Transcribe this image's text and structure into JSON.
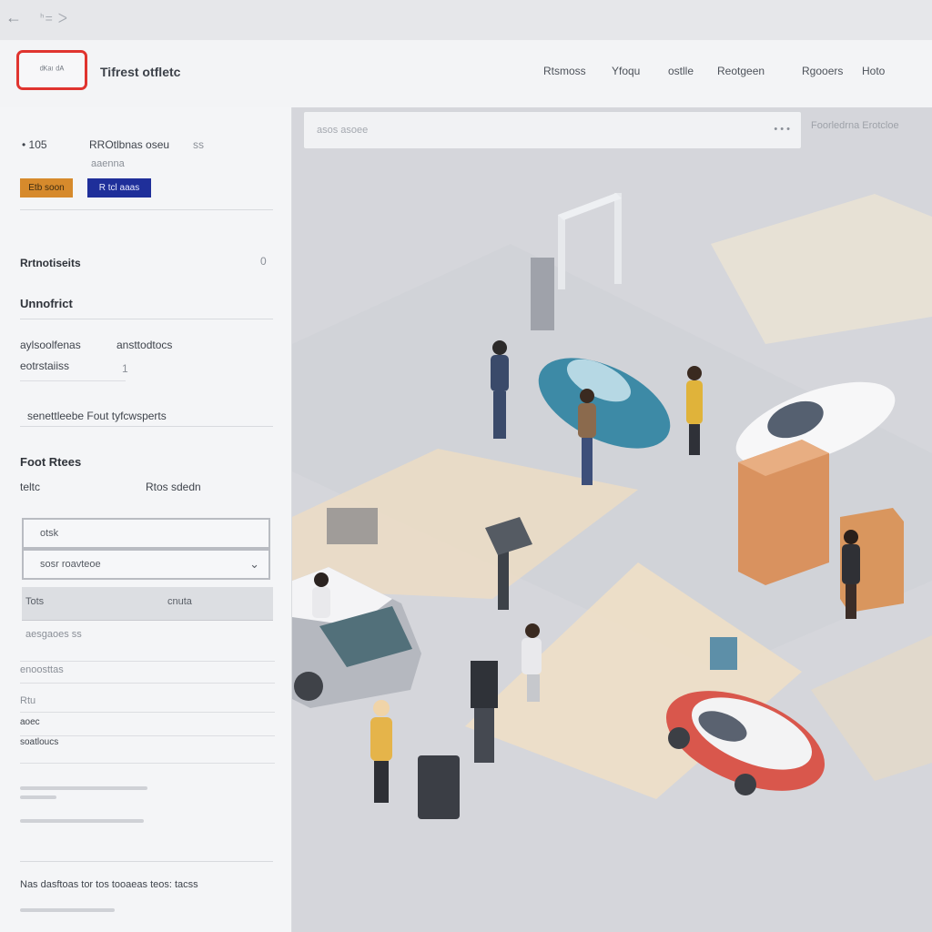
{
  "topbar": {
    "back_icon": "back-arrow-icon",
    "title": "ᑋ= ᐳ"
  },
  "header": {
    "logo_label": "ᵈᴷᵃᶦ ᵈᴬ",
    "title": "Tifrest otfletc",
    "nav": [
      "Rtsmoss",
      "Yfoqu",
      "ostlle",
      "Reotgeen",
      "Rgooers",
      "Hoto"
    ]
  },
  "sidebar": {
    "meta_left": "• 105",
    "meta_title": "RROtlbnas oseu",
    "meta_suffix": "ss",
    "meta_sub": "aaenna",
    "orange_button": "Etb soon",
    "blue_button": "R tcl aaas",
    "section1_title": "Rrtnotiseits",
    "section1_count": "0",
    "section2_title": "Unnofrict",
    "row1_left": "aylsoolfenas",
    "row1_right": "ansttodtocs",
    "row2_left": "eotrstaiiss",
    "row2_right": "1",
    "link_row": "senettleebe Fout tyfcwsperts",
    "section3_title": "Foot Rtees",
    "price_label": "teltc",
    "price_value": "Rtos sdedn",
    "input_value": "otsk",
    "select_value": "sosr roavteoe",
    "grey_left": "Tots",
    "grey_right": "cnuta",
    "small_note": "aesgaoes ss",
    "list": [
      "enoosttas",
      "Rtu",
      "aoec",
      "soatloucs"
    ],
    "footer_text": "Nas dasftoas tor tos tooaeas teos: tacss"
  },
  "main": {
    "search_placeholder": "asos asoee",
    "search_more": "• • •",
    "caption": "Foorledrna Erotcloe"
  }
}
